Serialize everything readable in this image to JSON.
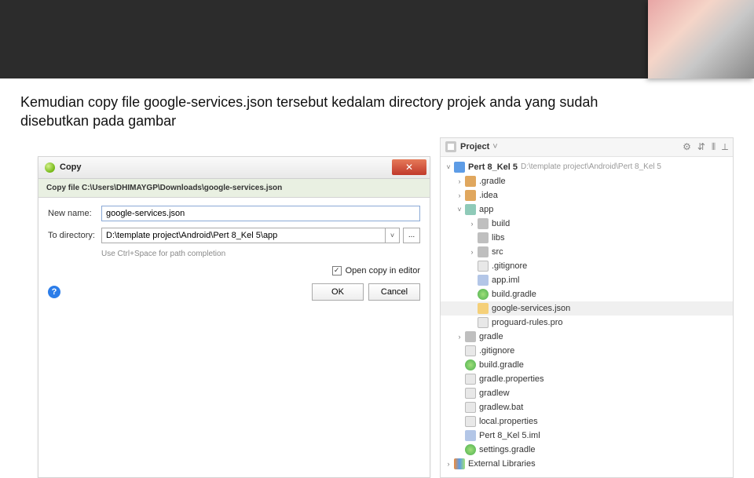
{
  "instruction": "Kemudian copy file google-services.json tersebut kedalam directory projek anda yang sudah disebutkan pada gambar",
  "dialog": {
    "title": "Copy",
    "copy_path": "Copy file C:\\Users\\DHIMAYGP\\Downloads\\google-services.json",
    "name_label": "New name:",
    "name_value": "google-services.json",
    "dir_label": "To directory:",
    "dir_value": "D:\\template project\\Android\\Pert 8_Kel 5\\app",
    "hint": "Use Ctrl+Space for path completion",
    "open_label": "Open copy in editor",
    "ok": "OK",
    "cancel": "Cancel",
    "close": "✕",
    "browse": "...",
    "chev": "˅",
    "check": "✓",
    "help": "?"
  },
  "panel": {
    "title": "Project",
    "tools": {
      "gear": "⚙",
      "sort": "⇵",
      "split": "⫴",
      "collapse": "⟂"
    },
    "root": {
      "name": "Pert 8_Kel 5",
      "path": "D:\\template project\\Android\\Pert 8_Kel 5"
    },
    "gradle_f": ".gradle",
    "idea_f": ".idea",
    "app": "app",
    "build": "build",
    "libs": "libs",
    "src": "src",
    "gitignore": ".gitignore",
    "app_iml": "app.iml",
    "build_gradle": "build.gradle",
    "gs_json": "google-services.json",
    "proguard": "proguard-rules.pro",
    "gradle_root": "gradle",
    "gitignore2": ".gitignore",
    "build_gradle2": "build.gradle",
    "gradle_props": "gradle.properties",
    "gradlew": "gradlew",
    "gradlew_bat": "gradlew.bat",
    "local_props": "local.properties",
    "proj_iml": "Pert 8_Kel 5.iml",
    "settings_gradle": "settings.gradle",
    "ext_libs": "External Libraries",
    "arr_d": "˅",
    "arr_r": "›"
  }
}
